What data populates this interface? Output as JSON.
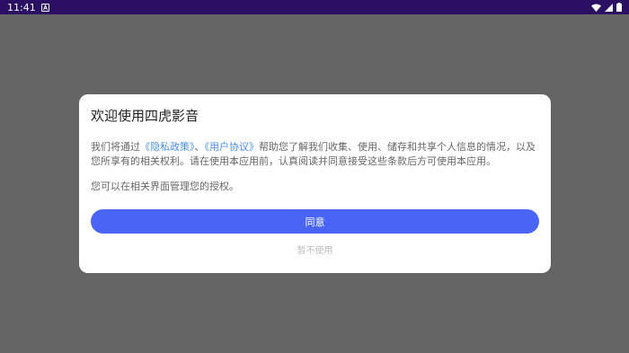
{
  "status_bar": {
    "time": "11:41",
    "notification_icon": "a-badge-icon",
    "wifi_icon": "wifi-icon",
    "signal_icon": "cell-signal-icon",
    "battery_icon": "battery-icon"
  },
  "dialog": {
    "title": "欢迎使用四虎影音",
    "body_part1": "我们将通过",
    "privacy_policy_link": "《隐私政策》",
    "separator": "、",
    "user_agreement_link": "《用户协议》",
    "body_part2": "帮助您了解我们收集、使用、储存和共享个人信息的情况，以及您所享有的相关权利。请在使用本应用前，认真阅读并同意接受这些条款后方可使用本应用。",
    "manage_text": "您可以在相关界面管理您的授权。",
    "agree_label": "同意",
    "decline_label": "暂不使用"
  },
  "colors": {
    "status_bar_bg": "#2a0f63",
    "overlay_bg": "#646464",
    "link": "#4a90e2",
    "primary_button": "#4a65f5",
    "decline_text": "#bdbdbd"
  }
}
